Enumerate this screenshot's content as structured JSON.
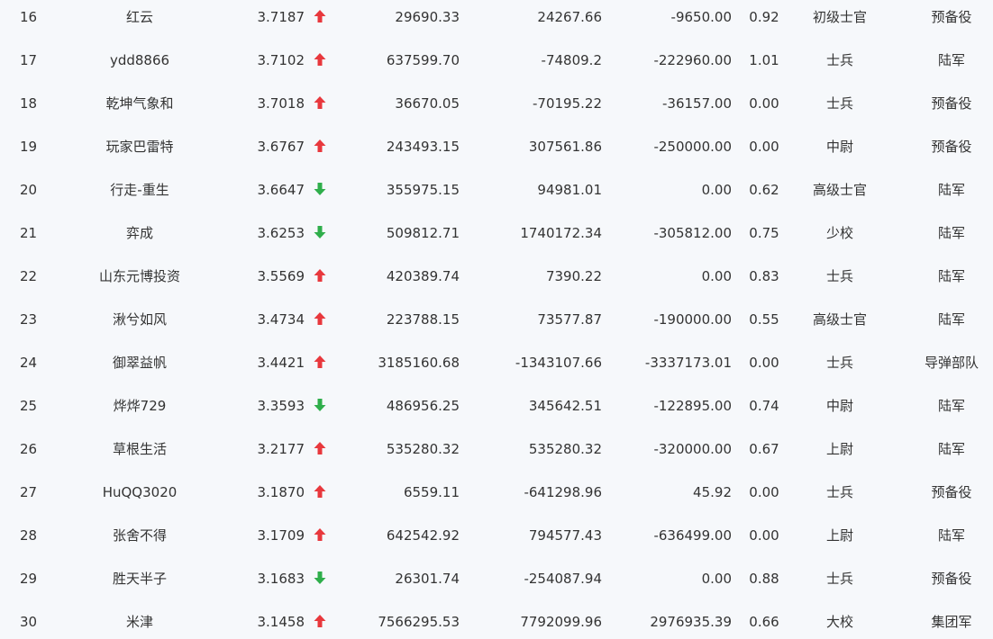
{
  "colors": {
    "background": "#f6f8fb",
    "text": "#333333",
    "up": "#e8383d",
    "down": "#2fae4b"
  },
  "rows": [
    {
      "rank": "16",
      "name": "红云",
      "score": "3.7187",
      "trend": "up",
      "v1": "29690.33",
      "v2": "24267.66",
      "v3": "-9650.00",
      "ratio": "0.92",
      "military_rank": "初级士官",
      "branch": "预备役"
    },
    {
      "rank": "17",
      "name": "ydd8866",
      "score": "3.7102",
      "trend": "up",
      "v1": "637599.70",
      "v2": "-74809.2",
      "v3": "-222960.00",
      "ratio": "1.01",
      "military_rank": "士兵",
      "branch": "陆军"
    },
    {
      "rank": "18",
      "name": "乾坤气象和",
      "score": "3.7018",
      "trend": "up",
      "v1": "36670.05",
      "v2": "-70195.22",
      "v3": "-36157.00",
      "ratio": "0.00",
      "military_rank": "士兵",
      "branch": "预备役"
    },
    {
      "rank": "19",
      "name": "玩家巴雷特",
      "score": "3.6767",
      "trend": "up",
      "v1": "243493.15",
      "v2": "307561.86",
      "v3": "-250000.00",
      "ratio": "0.00",
      "military_rank": "中尉",
      "branch": "预备役"
    },
    {
      "rank": "20",
      "name": "行走-重生",
      "score": "3.6647",
      "trend": "down",
      "v1": "355975.15",
      "v2": "94981.01",
      "v3": "0.00",
      "ratio": "0.62",
      "military_rank": "高级士官",
      "branch": "陆军"
    },
    {
      "rank": "21",
      "name": "弈成",
      "score": "3.6253",
      "trend": "down",
      "v1": "509812.71",
      "v2": "1740172.34",
      "v3": "-305812.00",
      "ratio": "0.75",
      "military_rank": "少校",
      "branch": "陆军"
    },
    {
      "rank": "22",
      "name": "山东元博投资",
      "score": "3.5569",
      "trend": "up",
      "v1": "420389.74",
      "v2": "7390.22",
      "v3": "0.00",
      "ratio": "0.83",
      "military_rank": "士兵",
      "branch": "陆军"
    },
    {
      "rank": "23",
      "name": "湫兮如风",
      "score": "3.4734",
      "trend": "up",
      "v1": "223788.15",
      "v2": "73577.87",
      "v3": "-190000.00",
      "ratio": "0.55",
      "military_rank": "高级士官",
      "branch": "陆军"
    },
    {
      "rank": "24",
      "name": "御翠益帆",
      "score": "3.4421",
      "trend": "up",
      "v1": "3185160.68",
      "v2": "-1343107.66",
      "v3": "-3337173.01",
      "ratio": "0.00",
      "military_rank": "士兵",
      "branch": "导弹部队"
    },
    {
      "rank": "25",
      "name": "烨烨729",
      "score": "3.3593",
      "trend": "down",
      "v1": "486956.25",
      "v2": "345642.51",
      "v3": "-122895.00",
      "ratio": "0.74",
      "military_rank": "中尉",
      "branch": "陆军"
    },
    {
      "rank": "26",
      "name": "草根生活",
      "score": "3.2177",
      "trend": "up",
      "v1": "535280.32",
      "v2": "535280.32",
      "v3": "-320000.00",
      "ratio": "0.67",
      "military_rank": "上尉",
      "branch": "陆军"
    },
    {
      "rank": "27",
      "name": "HuQQ3020",
      "score": "3.1870",
      "trend": "up",
      "v1": "6559.11",
      "v2": "-641298.96",
      "v3": "45.92",
      "ratio": "0.00",
      "military_rank": "士兵",
      "branch": "预备役"
    },
    {
      "rank": "28",
      "name": "张舍不得",
      "score": "3.1709",
      "trend": "up",
      "v1": "642542.92",
      "v2": "794577.43",
      "v3": "-636499.00",
      "ratio": "0.00",
      "military_rank": "上尉",
      "branch": "陆军"
    },
    {
      "rank": "29",
      "name": "胜天半子",
      "score": "3.1683",
      "trend": "down",
      "v1": "26301.74",
      "v2": "-254087.94",
      "v3": "0.00",
      "ratio": "0.88",
      "military_rank": "士兵",
      "branch": "预备役"
    },
    {
      "rank": "30",
      "name": "米津",
      "score": "3.1458",
      "trend": "up",
      "v1": "7566295.53",
      "v2": "7792099.96",
      "v3": "2976935.39",
      "ratio": "0.66",
      "military_rank": "大校",
      "branch": "集团军"
    }
  ]
}
